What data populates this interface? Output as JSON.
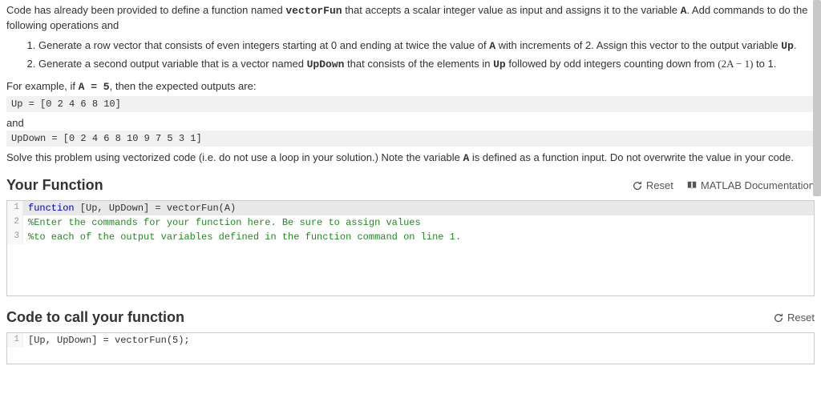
{
  "intro": {
    "prefix": "Code has already been provided to define a function named ",
    "fnName": "vectorFun",
    "mid": " that accepts a scalar integer value as input and assigns it to the variable ",
    "varA": "A",
    "suffix": ".  Add commands to do the following operations and "
  },
  "steps": [
    {
      "t1": "Generate a row vector that consists of even integers starting at 0 and ending at twice the value of ",
      "b1": "A",
      "t2": " with increments of 2.  Assign this vector to the output variable ",
      "b2": "Up",
      "t3": "."
    },
    {
      "t1": "Generate a second output variable that is a vector named ",
      "b1": "UpDown",
      "t2": " that consists of the elements in ",
      "b2": "Up",
      "t3": " followed by odd integers counting down from ",
      "math": "(2A − 1)",
      "t4": " to 1."
    }
  ],
  "example": {
    "intro_prefix": "For example, if ",
    "intro_eq": "A = 5",
    "intro_suffix": ", then the expected outputs are:",
    "up_code": "Up = [0 2 4 6 8 10]",
    "and": "and",
    "updown_code": "UpDown = [0 2 4 6 8 10 9 7 5 3 1]"
  },
  "note": {
    "t1": "Solve this problem using vectorized code (i.e. do not use a loop in your solution.)  Note the variable ",
    "b1": "A",
    "t2": " is defined as a function input.  Do not overwrite the value in your code."
  },
  "sections": {
    "your_function": "Your Function",
    "reset": "Reset",
    "matlab_doc": "MATLAB Documentation",
    "call_function": "Code to call your function"
  },
  "editor1": {
    "lines": [
      {
        "n": "1",
        "kw": "function",
        "rest": " [Up, UpDown] = vectorFun(A)"
      },
      {
        "n": "2",
        "comment": "%Enter the commands for your function here. Be sure to assign values"
      },
      {
        "n": "3",
        "comment": "%to each of the output variables defined in the function command on line 1."
      }
    ]
  },
  "editor2": {
    "lines": [
      {
        "n": "1",
        "code": "[Up, UpDown] = vectorFun(5);"
      }
    ]
  }
}
